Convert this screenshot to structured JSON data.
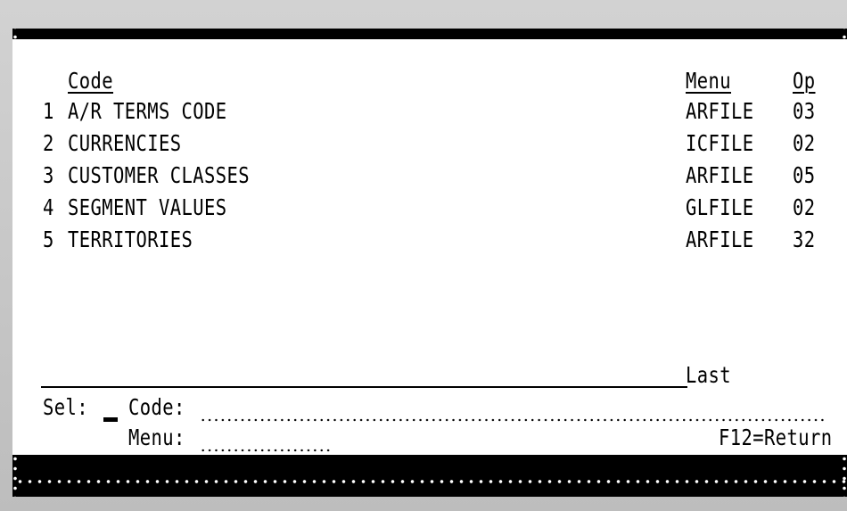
{
  "header": {
    "code": "Code",
    "menu": "Menu",
    "op": "Op"
  },
  "rows": [
    {
      "num": "1",
      "code": "A/R TERMS CODE",
      "menu": "ARFILE",
      "op": "03"
    },
    {
      "num": "2",
      "code": "CURRENCIES",
      "menu": "ICFILE",
      "op": "02"
    },
    {
      "num": "3",
      "code": "CUSTOMER CLASSES",
      "menu": "ARFILE",
      "op": "05"
    },
    {
      "num": "4",
      "code": "SEGMENT VALUES",
      "menu": "GLFILE",
      "op": "02"
    },
    {
      "num": "5",
      "code": "TERRITORIES",
      "menu": "ARFILE",
      "op": "32"
    }
  ],
  "status": "Last",
  "sel_label": "Sel:",
  "code_label": "Code:",
  "menu_label": "Menu:",
  "fkey": "F12=Return"
}
